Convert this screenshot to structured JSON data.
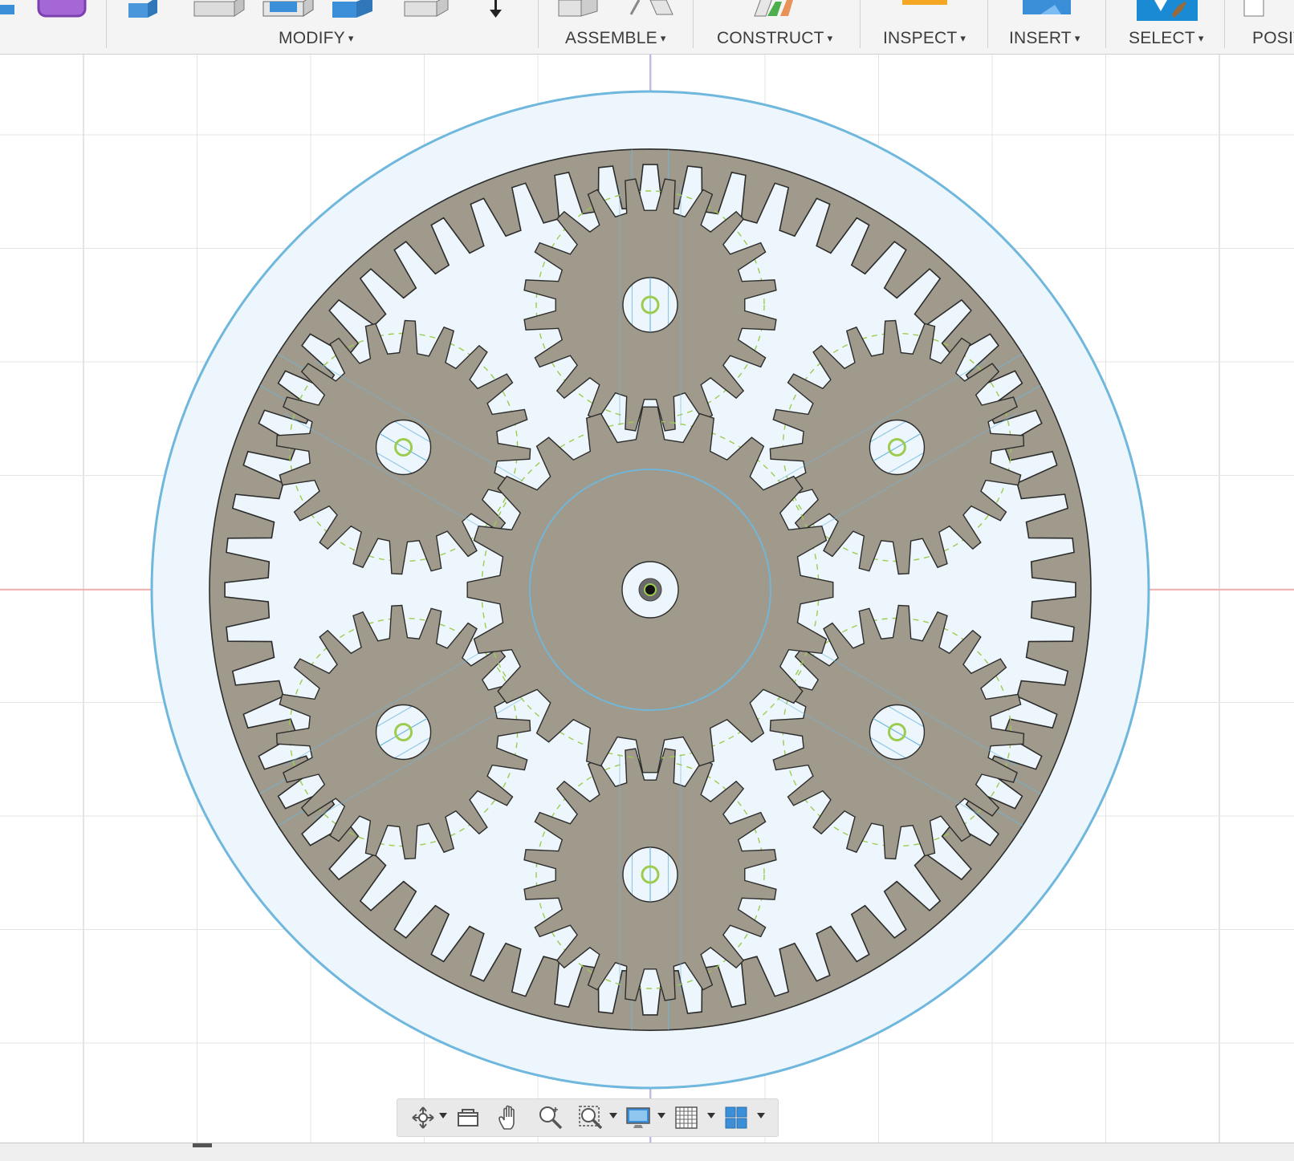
{
  "toolbar": {
    "modify_label": "MODIFY",
    "assemble_label": "ASSEMBLE",
    "construct_label": "CONSTRUCT",
    "inspect_label": "INSPECT",
    "insert_label": "INSERT",
    "select_label": "SELECT",
    "position_label": "POSIT",
    "caret": "▾"
  },
  "canvas": {
    "ring_gear_teeth": 60,
    "sun_gear_teeth": 20,
    "planet_gear_teeth": 20,
    "planet_count": 6,
    "colors": {
      "gear_fill": "#a09a8c",
      "gear_outline": "#2c2c2c",
      "selection_circle": "#6fb7dd",
      "selection_fill": "#ecf6fc",
      "pitch_circle": "#9ccc4e",
      "grid_line": "#e4e4e4",
      "axis_horizontal": "#f0a0a0",
      "axis_vertical": "#a6a6ee"
    }
  },
  "nav_bar": {
    "items": [
      "orbit-icon",
      "look-at-icon",
      "pan-icon",
      "zoom-icon",
      "fit-icon",
      "display-settings-icon",
      "grid-settings-icon",
      "viewports-icon"
    ]
  }
}
